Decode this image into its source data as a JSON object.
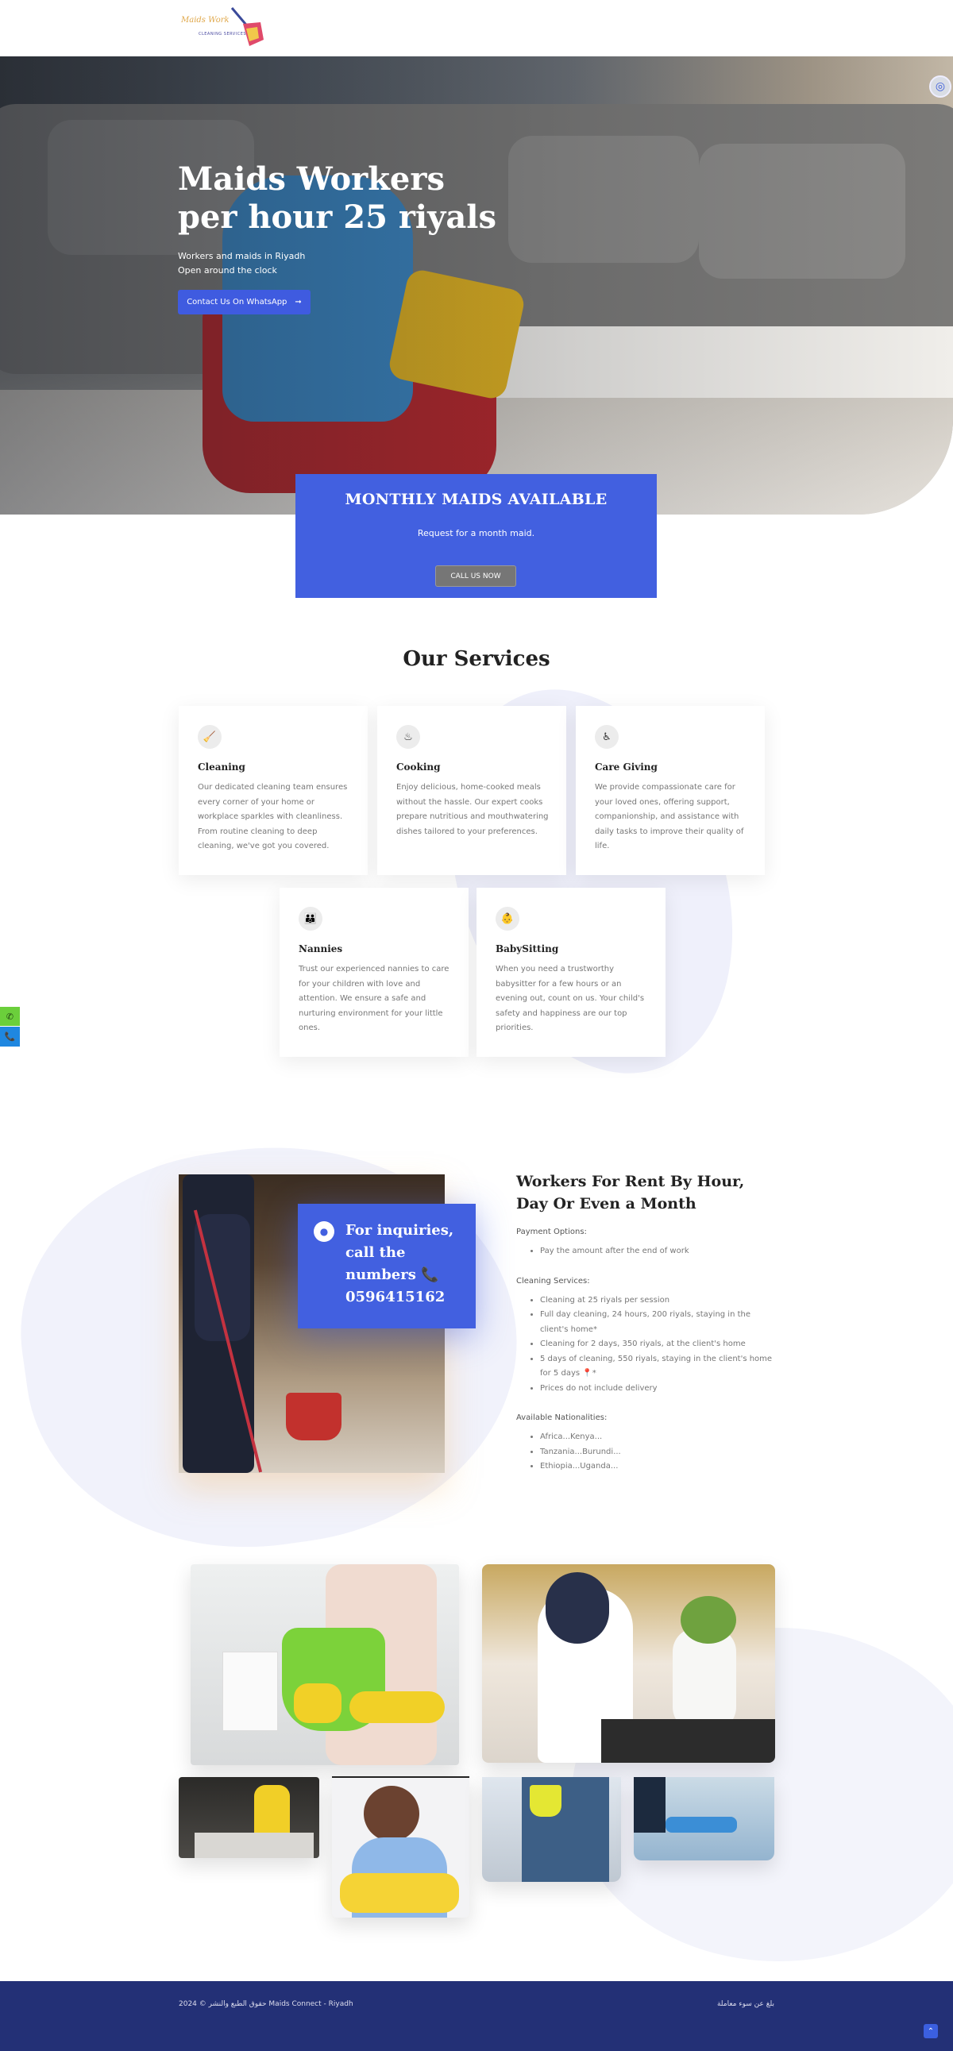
{
  "header": {
    "logo_line1": "Maids Work",
    "logo_line2": "CLEANING SERVICES"
  },
  "hero": {
    "title": "Maids Workers per hour 25 riyals",
    "sub_line1": "Workers and maids in Riyadh",
    "sub_line2": "Open around the clock",
    "cta_label": "Contact Us On WhatsApp",
    "cta_arrow": "➞"
  },
  "monthly": {
    "title": "MONTHLY MAIDS AVAILABLE",
    "text": "Request for a month maid.",
    "button": "CALL US NOW"
  },
  "services": {
    "title": "Our Services",
    "items": [
      {
        "icon": "cleaning-icon",
        "glyph": "🧹",
        "title": "Cleaning",
        "text": "Our dedicated cleaning team ensures every corner of your home or workplace sparkles with cleanliness. From routine cleaning to deep cleaning, we've got you covered."
      },
      {
        "icon": "cooking-icon",
        "glyph": "♨",
        "title": "Cooking",
        "text": "Enjoy delicious, home-cooked meals without the hassle. Our expert cooks prepare nutritious and mouthwatering dishes tailored to your preferences."
      },
      {
        "icon": "care-giving-icon",
        "glyph": "♿",
        "title": "Care Giving",
        "text": "We provide compassionate care for your loved ones, offering support, companionship, and assistance with daily tasks to improve their quality of life."
      },
      {
        "icon": "nannies-icon",
        "glyph": "👪",
        "title": "Nannies",
        "text": "Trust our experienced nannies to care for your children with love and attention. We ensure a safe and nurturing environment for your little ones."
      },
      {
        "icon": "babysitting-icon",
        "glyph": "👶",
        "title": "BabySitting",
        "text": "When you need a trustworthy babysitter for a few hours or an evening out, count on us. Your child's safety and happiness are our top priorities."
      }
    ]
  },
  "inquiry": {
    "text": "For inquiries, call the numbers 📞 0596415162"
  },
  "rent": {
    "title": "Workers For Rent By Hour, Day Or Even a Month",
    "payment_heading": "Payment Options:",
    "payment_items": [
      "Pay the amount after the end of work"
    ],
    "cleaning_heading": "Cleaning Services:",
    "cleaning_items": [
      "Cleaning at 25 riyals per session",
      "Full day cleaning, 24 hours, 200 riyals, staying in the client's home*",
      "Cleaning for 2 days, 350 riyals, at the client's home",
      "5 days of cleaning, 550 riyals, staying in the client's home for 5 days 📍*",
      "Prices do not include delivery"
    ],
    "nationalities_heading": "Available Nationalities:",
    "nationalities_items": [
      "Africa...Kenya...",
      "Tanzania...Burundi...",
      "Ethiopia...Uganda..."
    ]
  },
  "floating": {
    "whatsapp_glyph": "✆",
    "phone_glyph": "📞"
  },
  "footer": {
    "left": "2024 © حقوق الطبع والنشر Maids Connect - Riyadh",
    "right": "بلغ عن سوء معاملة",
    "top_glyph": "⌃"
  }
}
